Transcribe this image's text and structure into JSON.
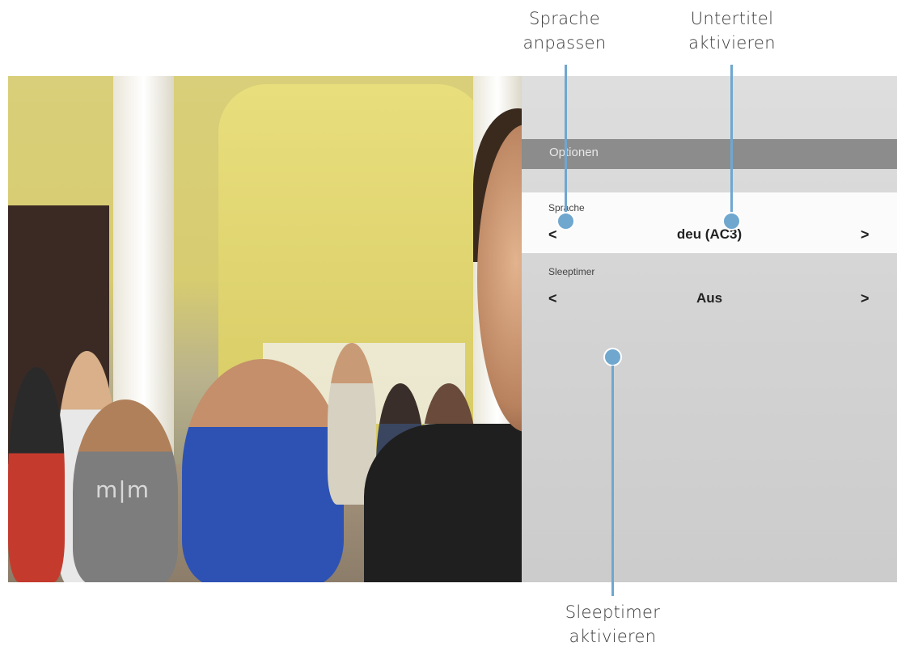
{
  "callouts": {
    "language": {
      "line1": "Sprache",
      "line2": "anpassen"
    },
    "subtitles": {
      "line1": "Untertitel",
      "line2": "aktivieren"
    },
    "sleeptimer": {
      "line1": "Sleeptimer",
      "line2": "aktivieren"
    }
  },
  "video": {
    "watermark": "m|m"
  },
  "options": {
    "title": "Optionen",
    "rows": [
      {
        "label": "Sprache",
        "prev": "<",
        "value": "deu (AC3)",
        "next": ">"
      },
      {
        "label": "Sleeptimer",
        "prev": "<",
        "value": "Aus",
        "next": ">"
      }
    ]
  },
  "colors": {
    "callout": "#6fa7cf",
    "title_bar": "#8c8c8c",
    "active_row": "#fbfbfb"
  }
}
